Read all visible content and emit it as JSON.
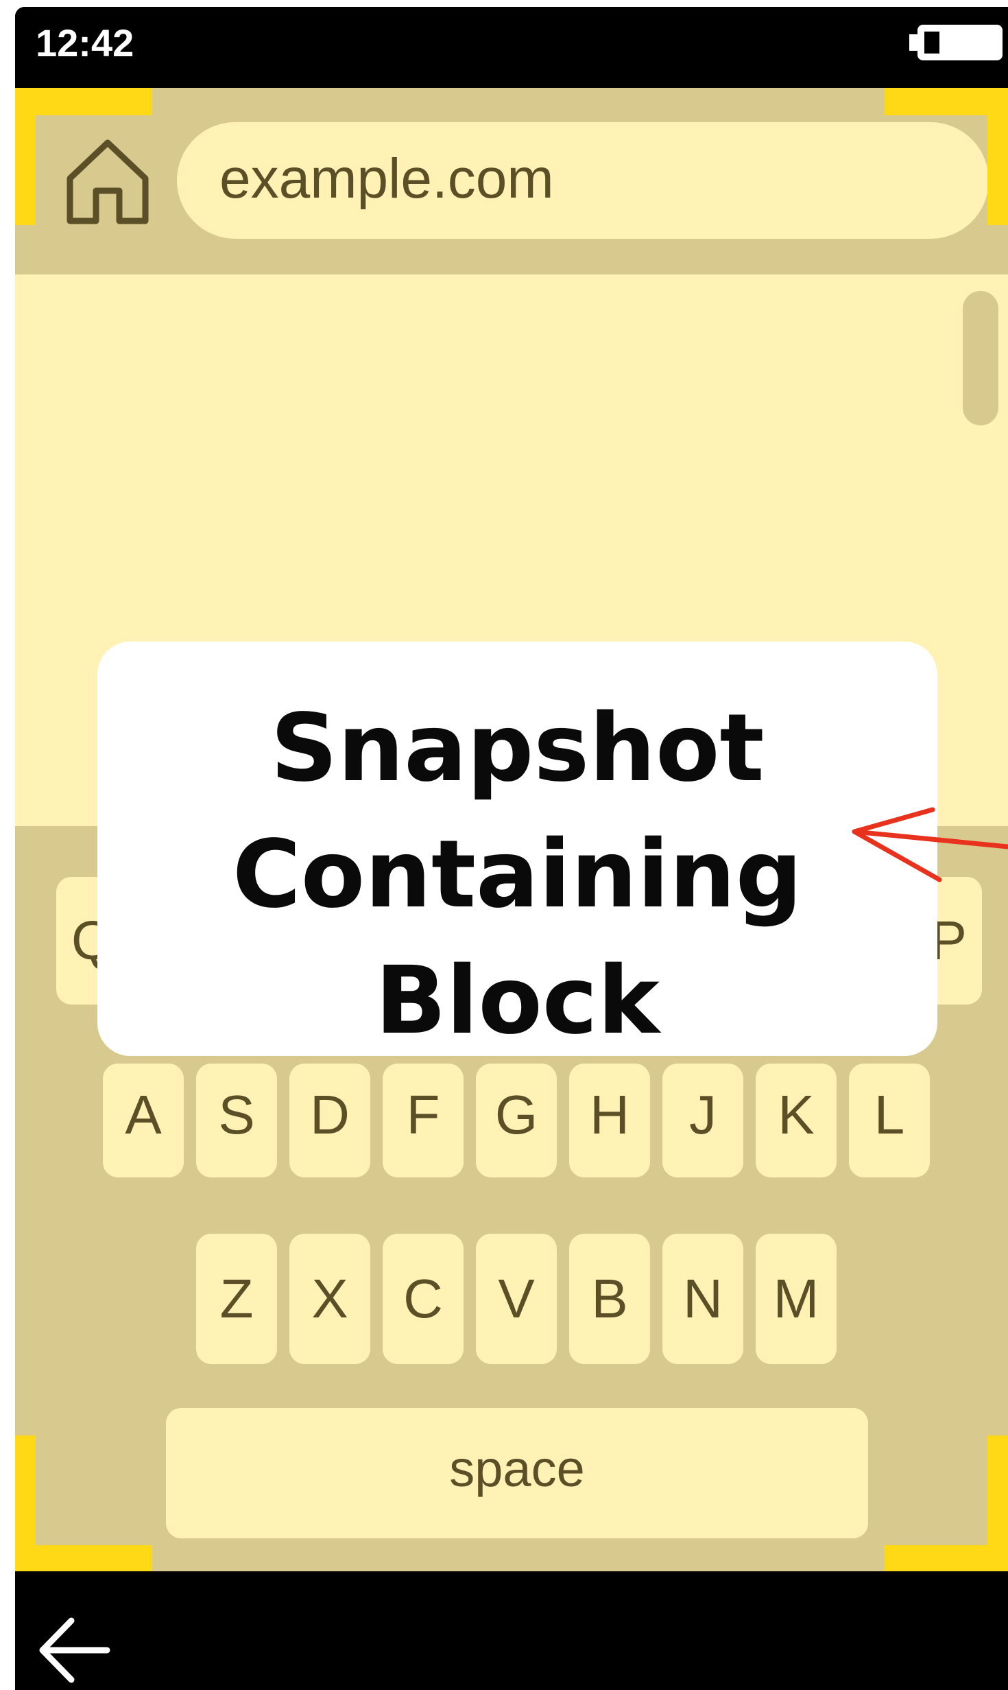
{
  "status_bar": {
    "time": "12:42"
  },
  "browser": {
    "url": "example.com",
    "home_icon": "home-icon"
  },
  "keyboard": {
    "row1": {
      "first": "Q",
      "last": "P"
    },
    "row2": [
      "A",
      "S",
      "D",
      "F",
      "G",
      "H",
      "J",
      "K",
      "L"
    ],
    "row3": [
      "Z",
      "X",
      "C",
      "V",
      "B",
      "N",
      "M"
    ],
    "space_label": "space"
  },
  "callout": {
    "text": "Snapshot Containing Block",
    "arrow_color": "#e8321e"
  },
  "colors": {
    "screen_bg": "#fff2b4",
    "chrome_bg": "#d8c98e",
    "accent_corners": "#ffd816",
    "text": "#5b4f28"
  },
  "nav": {
    "back_icon": "back-arrow-icon"
  }
}
